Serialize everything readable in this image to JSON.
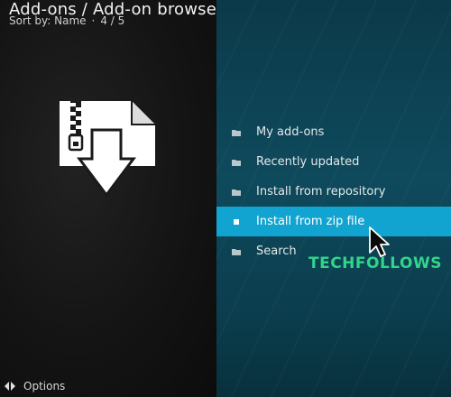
{
  "header": {
    "title": "Add-ons / Add-on browser",
    "sort_label": "Sort by: Name",
    "separator": "·",
    "position": "4 / 5"
  },
  "graphic": {
    "icon": "zip-file-download-icon"
  },
  "menu": {
    "items": [
      {
        "label": "My add-ons",
        "icon": "folder-icon",
        "selected": false
      },
      {
        "label": "Recently updated",
        "icon": "folder-icon",
        "selected": false
      },
      {
        "label": "Install from repository",
        "icon": "folder-icon",
        "selected": false
      },
      {
        "label": "Install from zip file",
        "icon": "folder-icon",
        "selected": true
      },
      {
        "label": "Search",
        "icon": "folder-icon",
        "selected": false
      }
    ],
    "selected_color": "#12a4d0"
  },
  "watermark": {
    "text": "TECHFOLLOWS",
    "color": "#30d58a"
  },
  "footer": {
    "options_label": "Options",
    "icon": "options-arrows-icon"
  }
}
